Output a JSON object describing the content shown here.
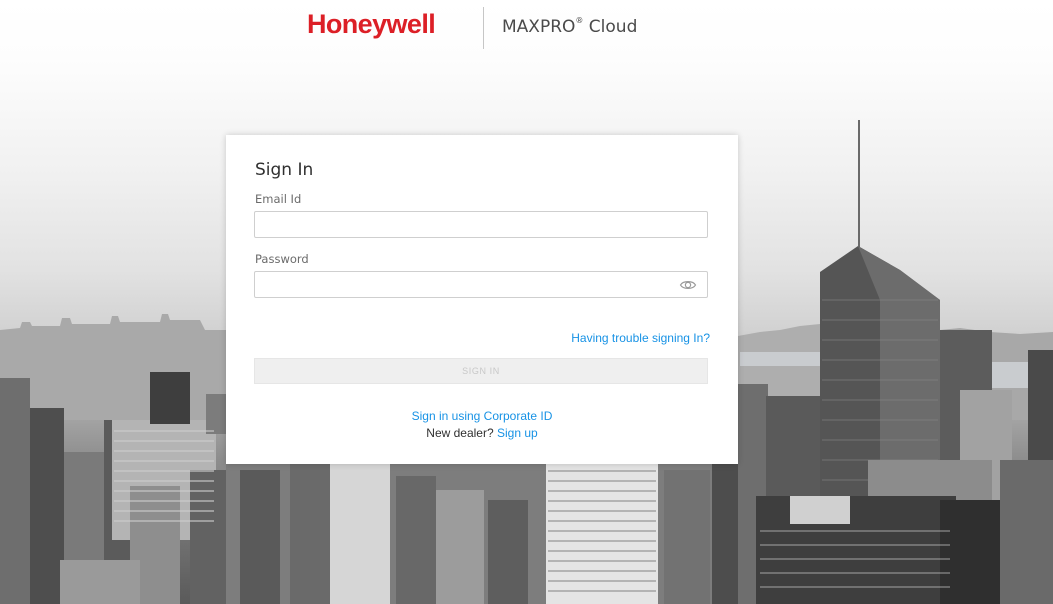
{
  "header": {
    "brand": "Honeywell",
    "product_name": "MAXPRO",
    "product_mark": "®",
    "product_suffix": " Cloud"
  },
  "signin": {
    "title": "Sign In",
    "email_label": "Email Id",
    "email_value": "",
    "password_label": "Password",
    "password_value": "",
    "trouble_link": "Having trouble signing In?",
    "button_label": "SIGN IN",
    "corporate_link": "Sign in using Corporate ID",
    "dealer_prompt": "New dealer? ",
    "signup_link": "Sign up"
  },
  "icons": {
    "password_toggle": "eye-icon"
  },
  "colors": {
    "brand_red": "#dc1f26",
    "link_blue": "#1792e5",
    "disabled_button_bg": "#efefef"
  }
}
